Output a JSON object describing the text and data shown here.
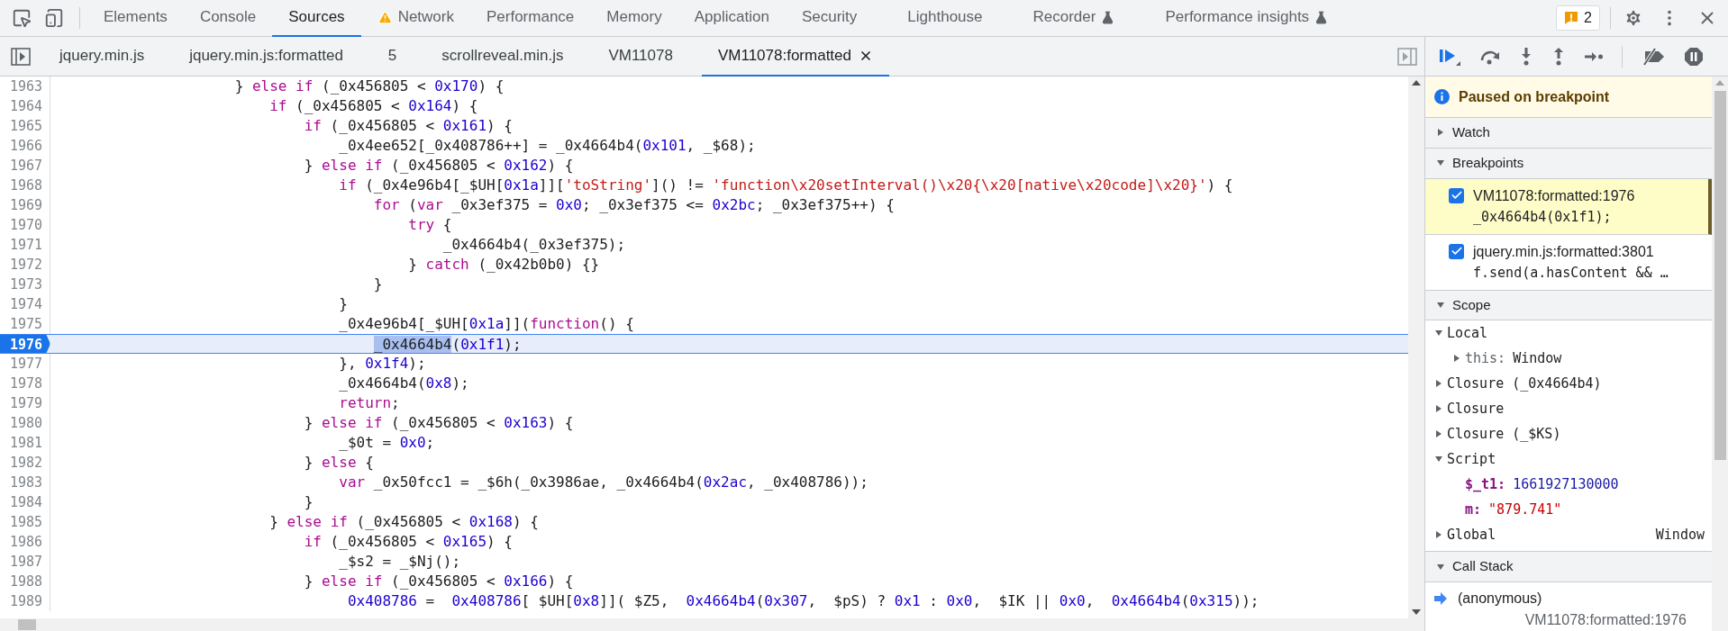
{
  "main_tabs": [
    {
      "label": "Elements",
      "selected": false,
      "warning": false,
      "experimental": false
    },
    {
      "label": "Console",
      "selected": false,
      "warning": false,
      "experimental": false
    },
    {
      "label": "Sources",
      "selected": true,
      "warning": false,
      "experimental": false
    },
    {
      "label": "Network",
      "selected": false,
      "warning": true,
      "experimental": false
    },
    {
      "label": "Performance",
      "selected": false,
      "warning": false,
      "experimental": false
    },
    {
      "label": "Memory",
      "selected": false,
      "warning": false,
      "experimental": false
    },
    {
      "label": "Application",
      "selected": false,
      "warning": false,
      "experimental": false
    },
    {
      "label": "Security",
      "selected": false,
      "warning": false,
      "experimental": false
    },
    {
      "label": "Lighthouse",
      "selected": false,
      "warning": false,
      "experimental": false
    },
    {
      "label": "Recorder",
      "selected": false,
      "warning": false,
      "experimental": true
    },
    {
      "label": "Performance insights",
      "selected": false,
      "warning": false,
      "experimental": true
    }
  ],
  "issues_badge": "2",
  "file_tabs": [
    {
      "label": "jquery.min.js",
      "selected": false
    },
    {
      "label": "jquery.min.js:formatted",
      "selected": false
    },
    {
      "label": "5",
      "selected": false
    },
    {
      "label": "scrollreveal.min.js",
      "selected": false
    },
    {
      "label": "VM11078",
      "selected": false
    },
    {
      "label": "VM11078:formatted",
      "selected": true
    }
  ],
  "code_lines": [
    {
      "number": "1963",
      "code": "                    } else if (_0x456805 < 0x170) {",
      "current": false,
      "selection": false
    },
    {
      "number": "1964",
      "code": "                        if (_0x456805 < 0x164) {",
      "current": false,
      "selection": false
    },
    {
      "number": "1965",
      "code": "                            if (_0x456805 < 0x161) {",
      "current": false,
      "selection": false
    },
    {
      "number": "1966",
      "code": "                                _0x4ee652[_0x408786++] = _0x4664b4(0x101, _$68);",
      "current": false,
      "selection": false
    },
    {
      "number": "1967",
      "code": "                            } else if (_0x456805 < 0x162) {",
      "current": false,
      "selection": false
    },
    {
      "number": "1968",
      "code": "                                if (_0x4e96b4[_$UH[0x1a]]['toString']() != 'function\\x20setInterval()\\x20{\\x20[native\\x20code]\\x20}') {",
      "current": false,
      "selection": false
    },
    {
      "number": "1969",
      "code": "                                    for (var _0x3ef375 = 0x0; _0x3ef375 <= 0x2bc; _0x3ef375++) {",
      "current": false,
      "selection": false
    },
    {
      "number": "1970",
      "code": "                                        try {",
      "current": false,
      "selection": false
    },
    {
      "number": "1971",
      "code": "                                            _0x4664b4(_0x3ef375);",
      "current": false,
      "selection": false
    },
    {
      "number": "1972",
      "code": "                                        } catch (_0x42b0b0) {}",
      "current": false,
      "selection": false
    },
    {
      "number": "1973",
      "code": "                                    }",
      "current": false,
      "selection": false
    },
    {
      "number": "1974",
      "code": "                                }",
      "current": false,
      "selection": false
    },
    {
      "number": "1975",
      "code": "                                _0x4e96b4[_$UH[0x1a]](function() {",
      "current": false,
      "selection": false
    },
    {
      "number": "1976",
      "code": "                                    _0x4664b4(0x1f1);",
      "current": true,
      "selection": true
    },
    {
      "number": "1977",
      "code": "                                }, 0x1f4);",
      "current": false,
      "selection": false
    },
    {
      "number": "1978",
      "code": "                                _0x4664b4(0x8);",
      "current": false,
      "selection": false
    },
    {
      "number": "1979",
      "code": "                                return;",
      "current": false,
      "selection": false
    },
    {
      "number": "1980",
      "code": "                            } else if (_0x456805 < 0x163) {",
      "current": false,
      "selection": false
    },
    {
      "number": "1981",
      "code": "                                _$0t = 0x0;",
      "current": false,
      "selection": false
    },
    {
      "number": "1982",
      "code": "                            } else {",
      "current": false,
      "selection": false
    },
    {
      "number": "1983",
      "code": "                                var _0x50fcc1 = _$6h(_0x3986ae, _0x4664b4(0x2ac, _0x408786));",
      "current": false,
      "selection": false
    },
    {
      "number": "1984",
      "code": "                            }",
      "current": false,
      "selection": false
    },
    {
      "number": "1985",
      "code": "                        } else if (_0x456805 < 0x168) {",
      "current": false,
      "selection": false
    },
    {
      "number": "1986",
      "code": "                            if (_0x456805 < 0x165) {",
      "current": false,
      "selection": false
    },
    {
      "number": "1987",
      "code": "                                _$s2 = _$Nj();",
      "current": false,
      "selection": false
    },
    {
      "number": "1988",
      "code": "                            } else if (_0x456805 < 0x166) {",
      "current": false,
      "selection": false
    },
    {
      "number": "1989",
      "code": "                                 0x408786 =  0x408786[ $UH[0x8]]( $Z5,  0x4664b4(0x307,  $pS) ? 0x1 : 0x0,  $IK || 0x0,  0x4664b4(0x315));",
      "current": false,
      "selection": false
    }
  ],
  "paused_message": "Paused on breakpoint",
  "watch": {
    "title": "Watch",
    "expanded": false
  },
  "breakpoints": {
    "title": "Breakpoints",
    "expanded": true,
    "items": [
      {
        "location": "VM11078:formatted:1976",
        "code": "_0x4664b4(0x1f1);",
        "checked": true,
        "active": true
      },
      {
        "location": "jquery.min.js:formatted:3801",
        "code": "f.send(a.hasContent && …",
        "checked": true,
        "active": false
      }
    ]
  },
  "scope": {
    "title": "Scope",
    "expanded": true,
    "items": [
      {
        "name": "Local",
        "expanded": true,
        "children": [
          {
            "name": "this:",
            "value": "Window",
            "kind": "object",
            "expanded": false
          }
        ]
      },
      {
        "name": "Closure (_0x4664b4)",
        "expanded": false
      },
      {
        "name": "Closure",
        "expanded": false
      },
      {
        "name": "Closure (_$KS)",
        "expanded": false
      },
      {
        "name": "Script",
        "expanded": true,
        "children": [
          {
            "name": "$_t1:",
            "value": "1661927130000",
            "kind": "number"
          },
          {
            "name": "m:",
            "value": "\"879.741\"",
            "kind": "string"
          }
        ]
      },
      {
        "name": "Global",
        "value": "Window",
        "expanded": false
      }
    ]
  },
  "call_stack": {
    "title": "Call Stack",
    "expanded": true,
    "frames": [
      {
        "function": "(anonymous)",
        "location": "VM11078:formatted:1976",
        "current": true
      }
    ]
  }
}
